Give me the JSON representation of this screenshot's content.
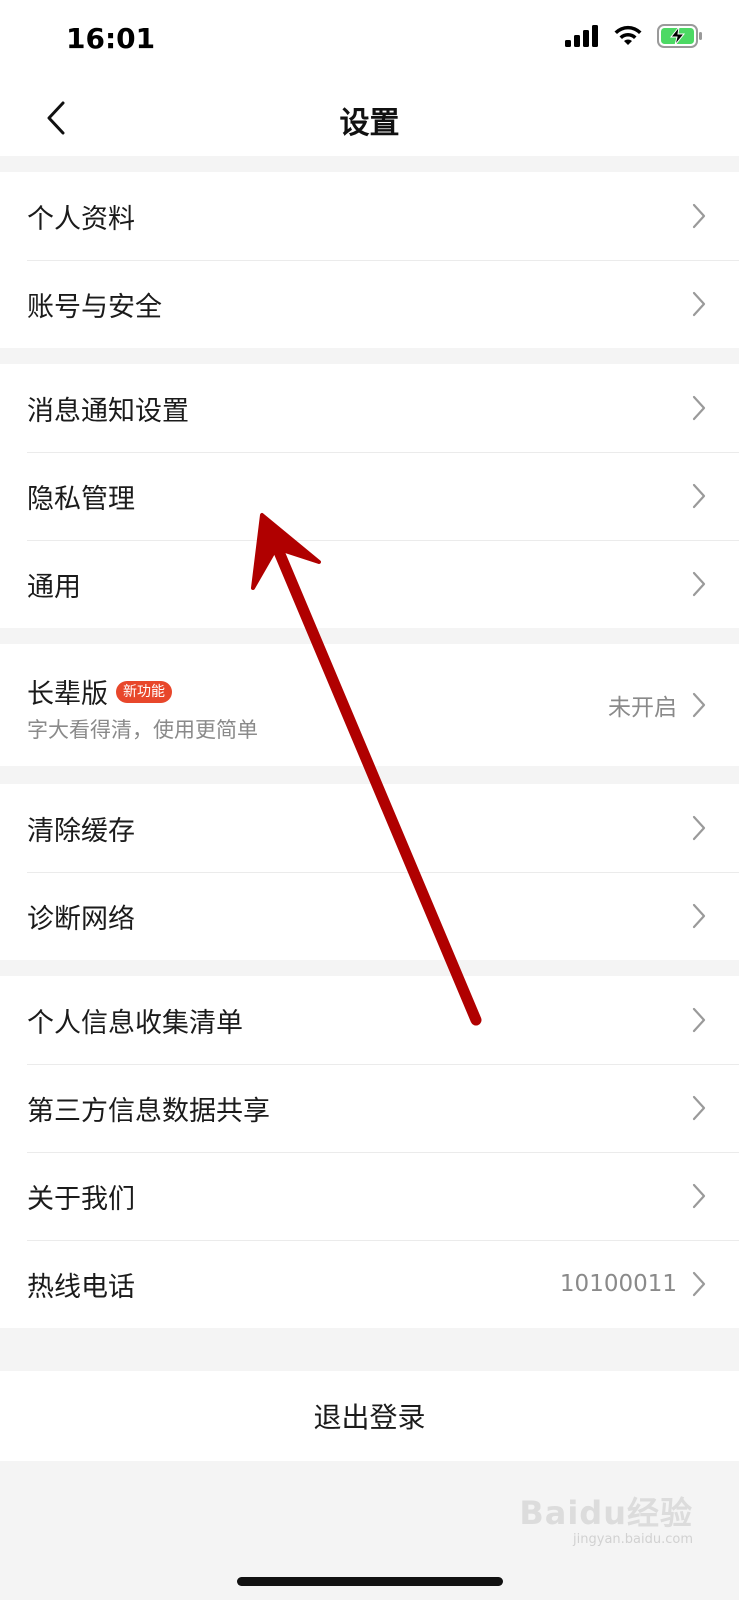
{
  "status_bar": {
    "time": "16:01"
  },
  "nav": {
    "title": "设置",
    "back_icon": "chevron-left-icon"
  },
  "groups": [
    {
      "items": [
        {
          "label": "个人资料"
        },
        {
          "label": "账号与安全"
        }
      ]
    },
    {
      "items": [
        {
          "label": "消息通知设置"
        },
        {
          "label": "隐私管理"
        },
        {
          "label": "通用"
        }
      ]
    },
    {
      "items": [
        {
          "label": "长辈版",
          "badge": "新功能",
          "subtitle": "字大看得清，使用更简单",
          "value": "未开启"
        }
      ]
    },
    {
      "items": [
        {
          "label": "清除缓存"
        },
        {
          "label": "诊断网络"
        }
      ]
    },
    {
      "items": [
        {
          "label": "个人信息收集清单"
        },
        {
          "label": "第三方信息数据共享"
        },
        {
          "label": "关于我们"
        },
        {
          "label": "热线电话",
          "value": "10100011"
        }
      ]
    }
  ],
  "logout_label": "退出登录",
  "watermark": {
    "logo": "Baidu经验",
    "url": "jingyan.baidu.com"
  },
  "colors": {
    "badge": "#e8472b",
    "arrow": "#b00000",
    "background": "#f4f4f4"
  }
}
